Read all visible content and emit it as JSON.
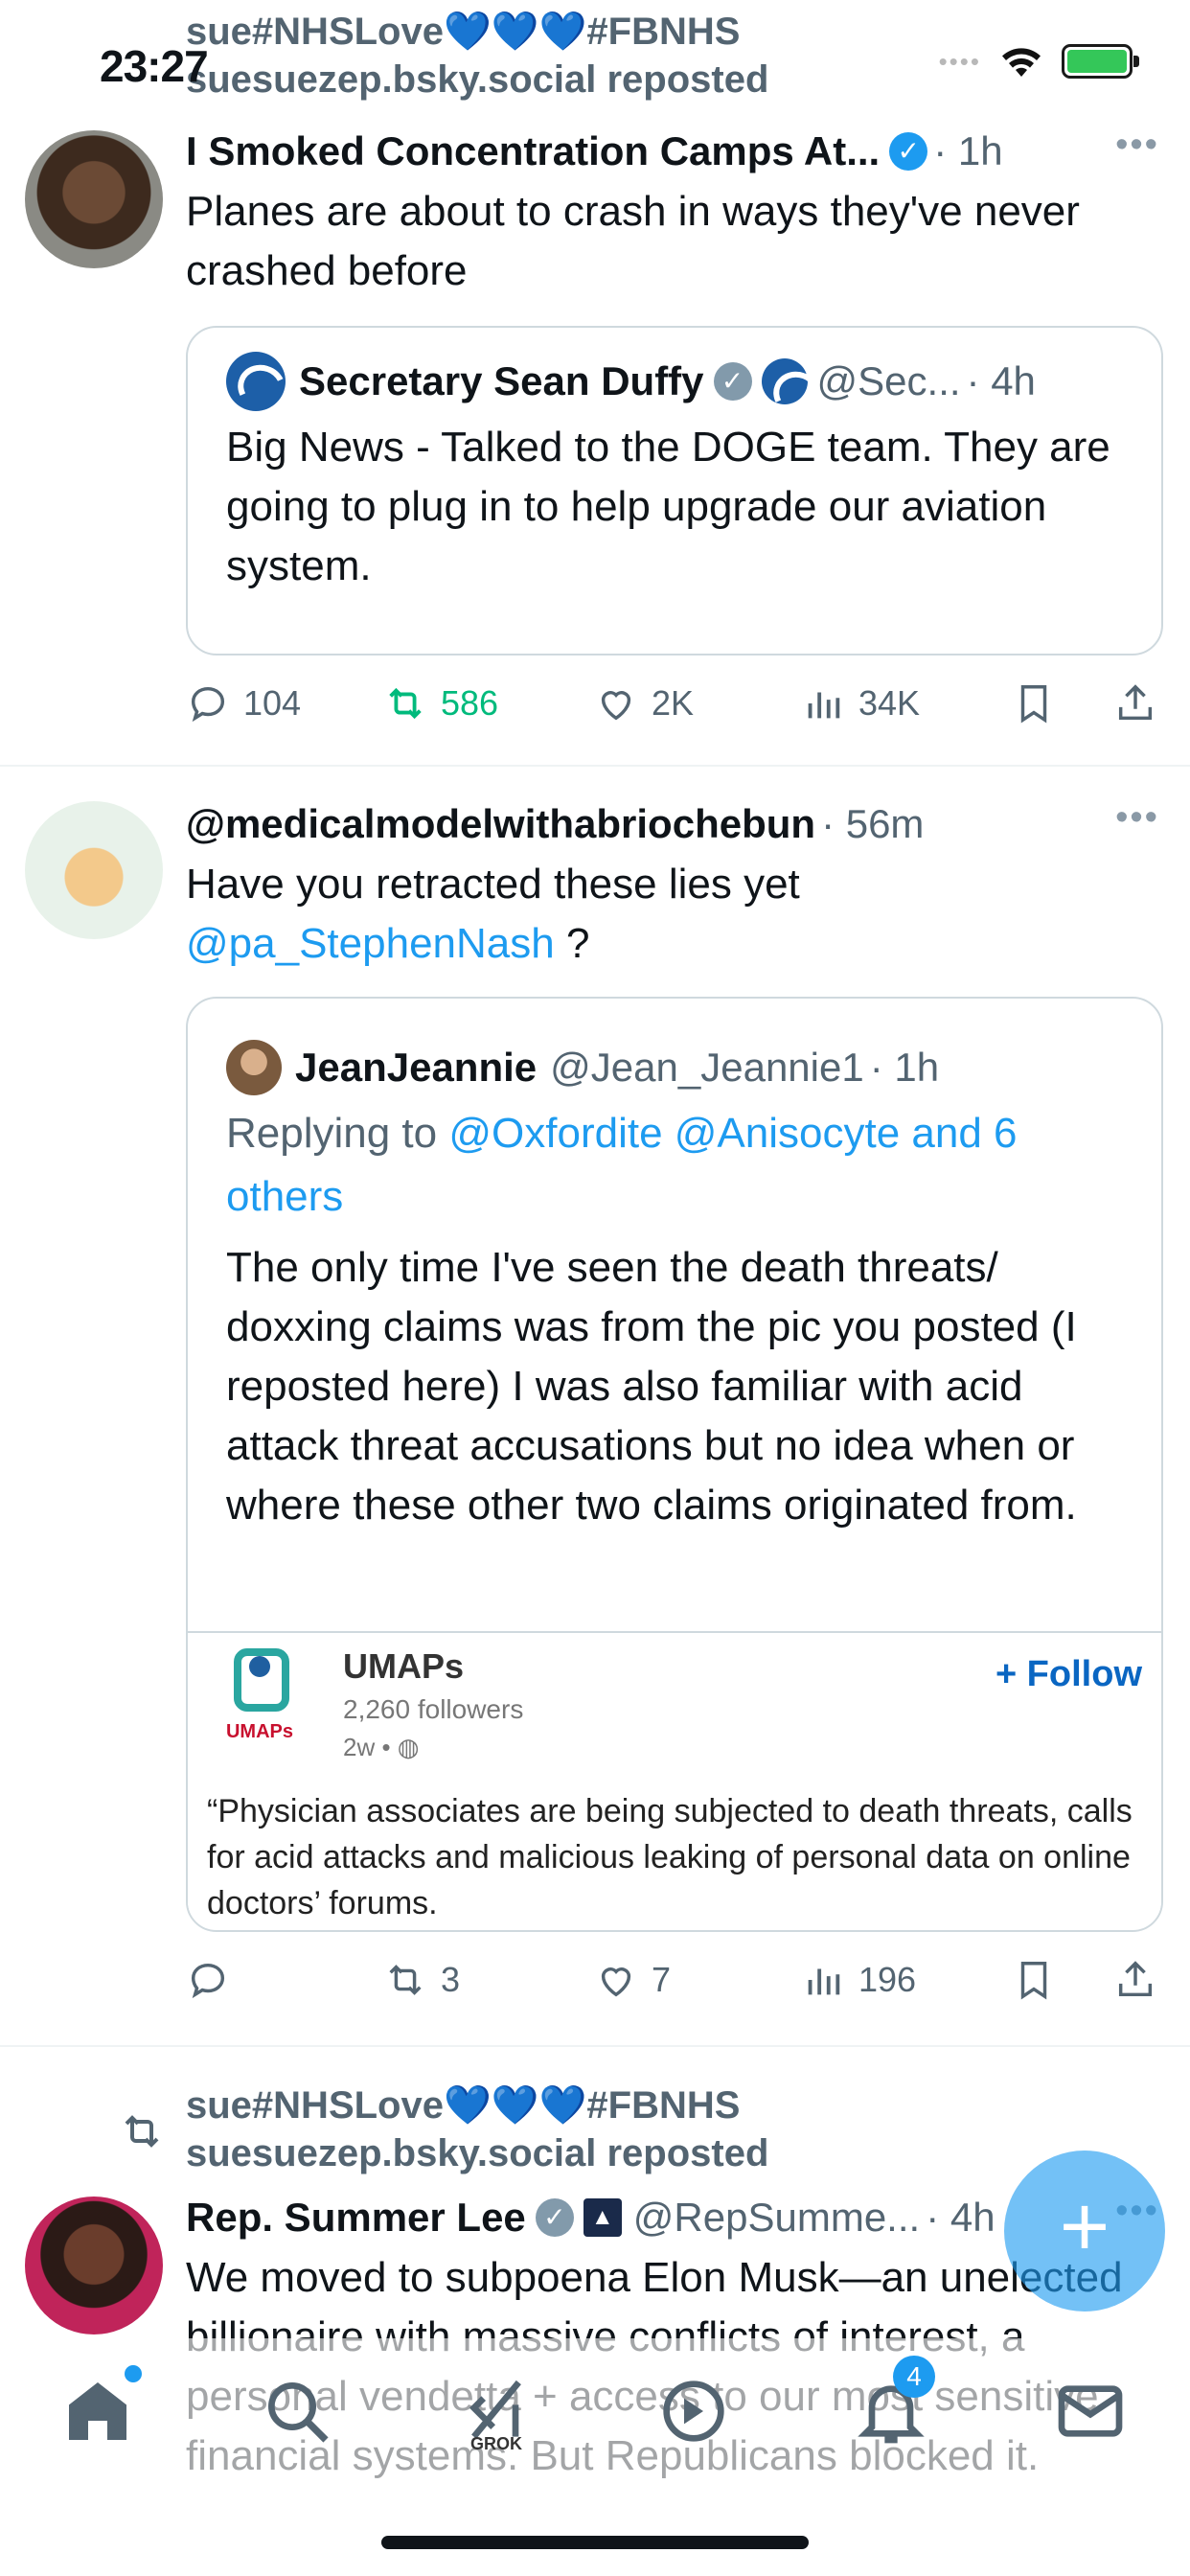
{
  "status_bar": {
    "time": "23:27"
  },
  "post1": {
    "repost_by": "sue#NHSLove",
    "repost_hearts": "💙💙💙",
    "repost_tag": "#FBNHS",
    "repost_handle": "suesuezep.bsky.social reposted",
    "name": "I Smoked Concentration Camps At...",
    "time": "· 1h",
    "text": "Planes are about to crash in ways they've never crashed before",
    "quote": {
      "name": "Secretary Sean Duffy",
      "handle": "@Sec...",
      "time": "· 4h",
      "text": "Big News - Talked to the DOGE team. They are going to plug in to help upgrade our aviation system."
    },
    "actions": {
      "replies": "104",
      "reposts": "586",
      "likes": "2K",
      "views": "34K"
    }
  },
  "post2": {
    "name": "@medicalmodelwithabriochebun",
    "time": "· 56m",
    "text": "Have you retracted these lies yet",
    "mention": "@pa_StephenNash",
    "text_end": " ?",
    "quote": {
      "name": "JeanJeannie",
      "handle": "@Jean_Jeannie1",
      "time": "· 1h",
      "replying_prefix": "Replying to ",
      "replying_to": "@Oxfordite @Anisocyte and 6 others",
      "text": "The only time I've seen the death threats/ doxxing claims was from the pic you posted (I reposted here) I was also familiar with acid attack threat accusations but no idea when or where these other two claims originated from.",
      "embed": {
        "org": "UMAPs",
        "logo_text": "UMAPs",
        "follow": "+ Follow",
        "followers": "2,260 followers",
        "age": "2w • ",
        "quote": "“Physician associates are being subjected to death threats, calls for acid attacks and malicious leaking of personal data on online doctors’ forums."
      }
    },
    "actions": {
      "replies": "",
      "reposts": "3",
      "likes": "7",
      "views": "196"
    }
  },
  "post3": {
    "repost_by": "sue#NHSLove",
    "repost_hearts": "💙💙💙",
    "repost_tag": "#FBNHS",
    "repost_handle": "suesuezep.bsky.social reposted",
    "name": "Rep. Summer Lee",
    "handle": "@RepSumme...",
    "time": "· 4h",
    "text": "We moved to subpoena Elon Musk—an unelected billionaire with massive conflicts of interest, a personal vendetta + access to our most sensitive financial systems. But Republicans blocked it."
  },
  "tab_bar": {
    "grok_label": "GROK",
    "notifications_count": "4"
  },
  "fab_label": "+"
}
